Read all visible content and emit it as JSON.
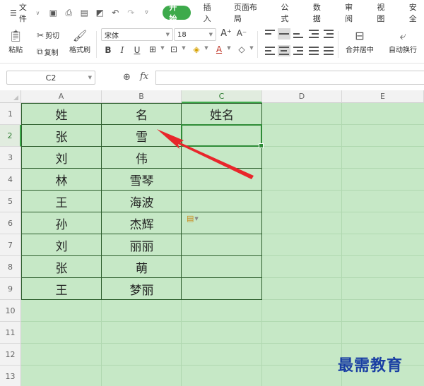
{
  "menu": {
    "file_label": "文件",
    "tabs": [
      "开始",
      "插入",
      "页面布局",
      "公式",
      "数据",
      "审阅",
      "视图",
      "安全"
    ],
    "active_tab": "开始"
  },
  "ribbon": {
    "paste_label": "粘贴",
    "cut_label": "剪切",
    "copy_label": "复制",
    "format_painter_label": "格式刷",
    "font_name": "宋体",
    "font_size": "18",
    "merge_center_label": "合并居中",
    "wrap_text_label": "自动换行"
  },
  "formula_bar": {
    "cell_ref": "C2",
    "fx_label": "fx",
    "formula": ""
  },
  "sheet": {
    "columns": [
      "A",
      "B",
      "C",
      "D",
      "E"
    ],
    "rows": [
      "1",
      "2",
      "3",
      "4",
      "5",
      "6",
      "7",
      "8",
      "9",
      "10",
      "11",
      "12",
      "13"
    ],
    "header": [
      "姓",
      "名",
      "姓名"
    ],
    "data": [
      [
        "张",
        "雪"
      ],
      [
        "刘",
        "伟"
      ],
      [
        "林",
        "雪琴"
      ],
      [
        "王",
        "海波"
      ],
      [
        "孙",
        "杰辉"
      ],
      [
        "刘",
        "丽丽"
      ],
      [
        "张",
        "萌"
      ],
      [
        "王",
        "梦丽"
      ]
    ],
    "selected_cell": "C2",
    "fill_color": "#c6e8c6",
    "accent_color": "#3daa4b"
  },
  "watermark": "最需教育"
}
